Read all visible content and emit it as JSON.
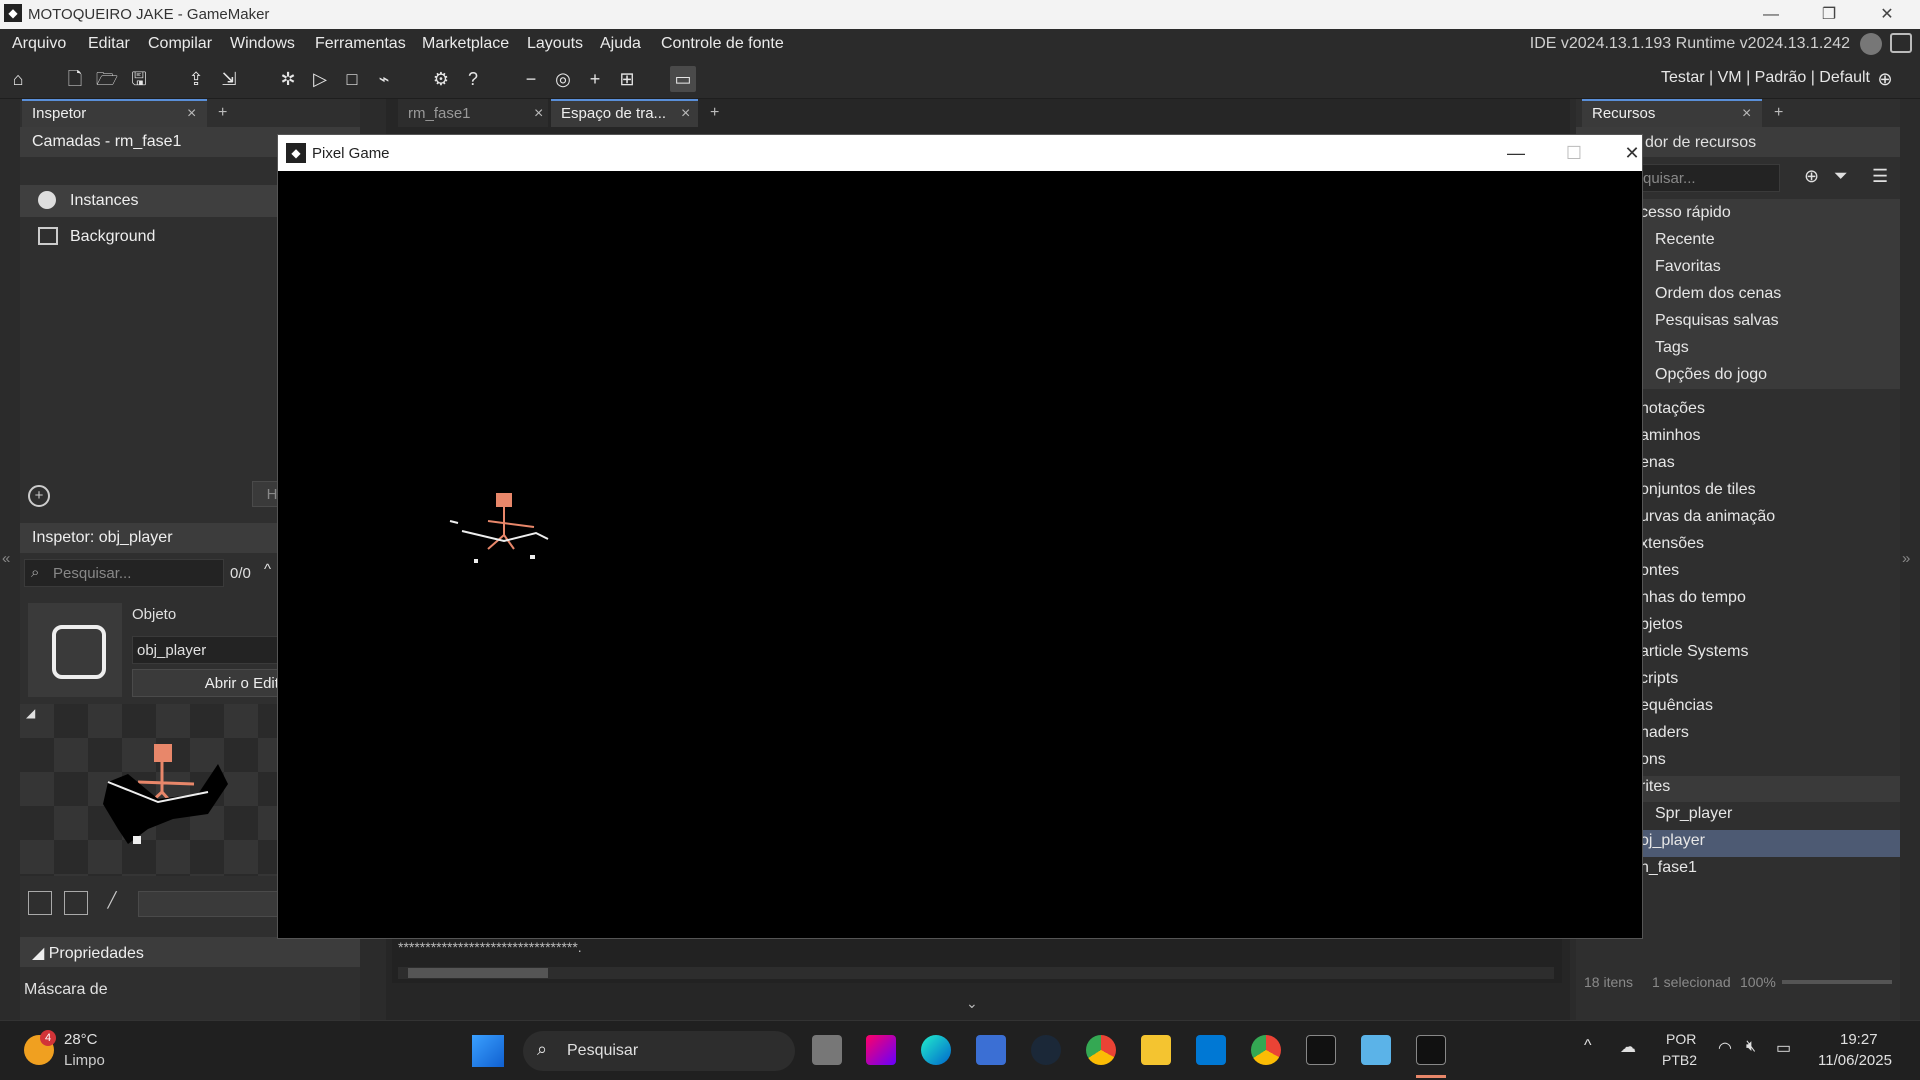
{
  "window": {
    "title": "MOTOQUEIRO JAKE - GameMaker"
  },
  "menu": [
    "Arquivo",
    "Editar",
    "Compilar",
    "Windows",
    "Ferramentas",
    "Marketplace",
    "Layouts",
    "Ajuda",
    "Controle de fonte"
  ],
  "version": "IDE v2024.13.1.193  Runtime v2024.13.1.242",
  "target": "Testar | VM | Padrão | Default",
  "left": {
    "tab": "Inspetor",
    "layers_header": "Camadas - rm_fase1",
    "layers": [
      "Instances",
      "Background"
    ],
    "inspector_header": "Inspetor: obj_player",
    "search_placeholder": "Pesquisar...",
    "search_count": "0/0",
    "object_label": "Objeto",
    "object_name": "obj_player",
    "open_editor": "Abrir o Edito",
    "sprite_name": "Spr_player",
    "properties": "Propriedades",
    "mask_label": "Máscara de",
    "layer_btn_partial": "H"
  },
  "center": {
    "tabs": [
      "rm_fase1",
      "Espaço de tra..."
    ],
    "output_line": "*********************************."
  },
  "right": {
    "tab": "Recursos",
    "header": "dor de recursos",
    "search_placeholder": "quisar...",
    "quick_access": "cesso rápido",
    "quick_items": [
      "Recente",
      "Favoritas",
      "Ordem dos cenas",
      "Pesquisas salvas",
      "Tags",
      "Opções do jogo"
    ],
    "groups": [
      "notações",
      "aminhos",
      "enas",
      "onjuntos de tiles",
      "urvas da animação",
      "xtensões",
      "ontes",
      "nhas do tempo",
      "bjetos",
      "article Systems",
      "cripts",
      "equências",
      "haders",
      "ons",
      "rites"
    ],
    "sprite_child": "Spr_player",
    "selected_item": "oj_player",
    "room_item": "n_fase1",
    "status_count": "18 itens",
    "status_selected": "1 selecionad",
    "zoom": "100%"
  },
  "game_window": {
    "title": "Pixel Game"
  },
  "taskbar": {
    "weather_temp": "28°C",
    "weather_desc": "Limpo",
    "weather_badge": "4",
    "search": "Pesquisar",
    "lang1": "POR",
    "lang2": "PTB2",
    "time": "19:27",
    "date": "11/06/2025"
  }
}
